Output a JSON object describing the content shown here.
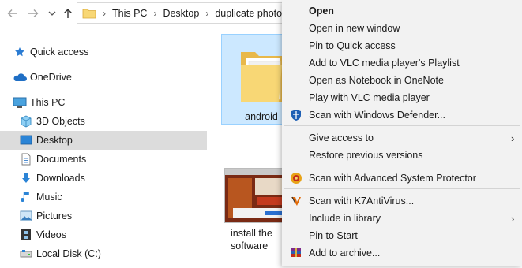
{
  "breadcrumb": [
    "This PC",
    "Desktop",
    "duplicate photos"
  ],
  "sidebar": {
    "items": [
      {
        "label": "Quick access",
        "icon": "star-icon"
      },
      {
        "label": "OneDrive",
        "icon": "cloud-icon"
      },
      {
        "label": "This PC",
        "icon": "computer-icon"
      },
      {
        "label": "3D Objects",
        "icon": "cube-icon"
      },
      {
        "label": "Desktop",
        "icon": "desktop-icon",
        "selected": true
      },
      {
        "label": "Documents",
        "icon": "document-icon"
      },
      {
        "label": "Downloads",
        "icon": "download-arrow-icon"
      },
      {
        "label": "Music",
        "icon": "music-note-icon"
      },
      {
        "label": "Pictures",
        "icon": "pictures-icon"
      },
      {
        "label": "Videos",
        "icon": "film-icon"
      },
      {
        "label": "Local Disk (C:)",
        "icon": "disk-icon"
      }
    ]
  },
  "files": {
    "folder_label": "android",
    "thumb_label": "install the\nsoftware"
  },
  "context_menu": {
    "items": [
      {
        "label": "Open",
        "bold": true
      },
      {
        "label": "Open in new window"
      },
      {
        "label": "Pin to Quick access"
      },
      {
        "label": "Add to VLC media player's Playlist"
      },
      {
        "label": "Open as Notebook in OneNote"
      },
      {
        "label": "Play with VLC media player"
      },
      {
        "label": "Scan with Windows Defender...",
        "icon": "windows-defender-icon"
      },
      {
        "label": "Give access to",
        "submenu": true
      },
      {
        "label": "Restore previous versions"
      },
      {
        "label": "Scan with Advanced System Protector",
        "icon": "shield-protector-icon"
      },
      {
        "label": "Scan with K7AntiVirus...",
        "icon": "k7-antivirus-icon"
      },
      {
        "label": "Include in library",
        "submenu": true
      },
      {
        "label": "Pin to Start"
      },
      {
        "label": "Add to archive...",
        "icon": "winrar-archive-icon"
      }
    ]
  },
  "colors": {
    "selection": "#cce8ff",
    "nav_selected": "#dcdcdc",
    "menu_bg": "#f2f2f2",
    "folder_yellow": "#f8d775"
  }
}
